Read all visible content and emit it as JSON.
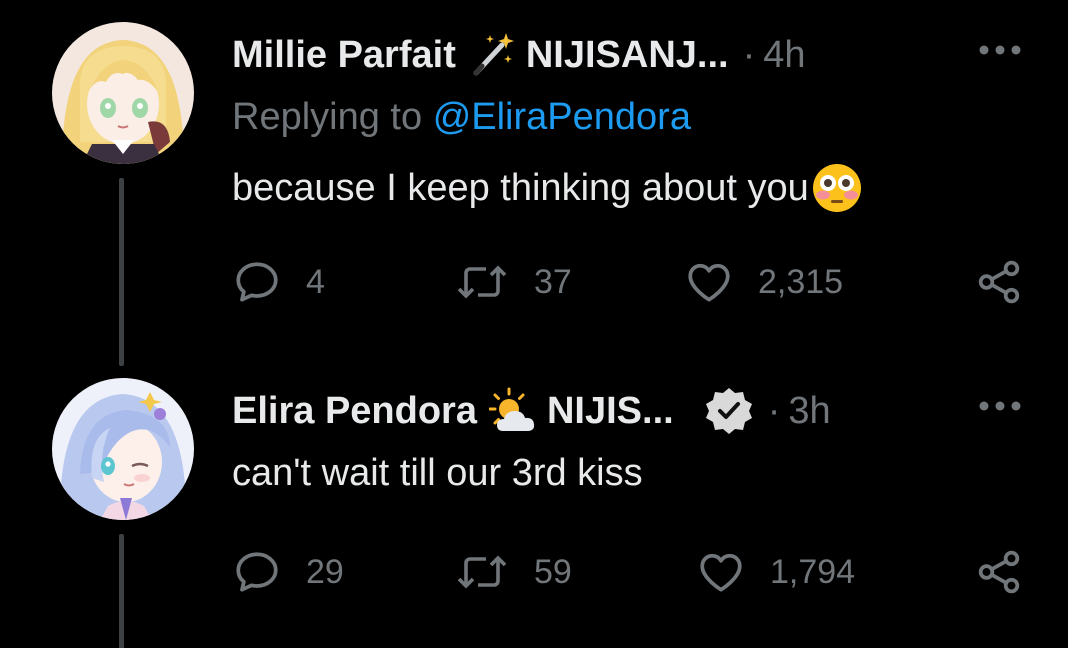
{
  "tweets": [
    {
      "display_name": "Millie Parfait",
      "badge_emoji": "magic-wand",
      "affiliation": "NIJISANJ...",
      "separator": "·",
      "time": "4h",
      "verified": false,
      "replying_prefix": "Replying to",
      "replying_handle": "@EliraPendora",
      "text": "because I keep thinking about you",
      "inline_emoji": "flushed-face",
      "replies": "4",
      "retweets": "37",
      "likes": "2,315"
    },
    {
      "display_name": "Elira Pendora",
      "badge_emoji": "sun-behind-cloud",
      "affiliation": "NIJIS...",
      "separator": "·",
      "time": "3h",
      "verified": true,
      "text": "can't wait till our 3rd kiss",
      "replies": "29",
      "retweets": "59",
      "likes": "1,794"
    }
  ],
  "colors": {
    "background": "#000000",
    "primary_text": "#e7e9ea",
    "secondary_text": "#71767b",
    "link": "#1d9bf0",
    "thread_line": "#3e4144"
  },
  "icons": {
    "more": "more-horizontal-icon",
    "reply": "reply-icon",
    "retweet": "retweet-icon",
    "like": "heart-icon",
    "share": "share-icon",
    "verified": "verified-badge-icon"
  }
}
